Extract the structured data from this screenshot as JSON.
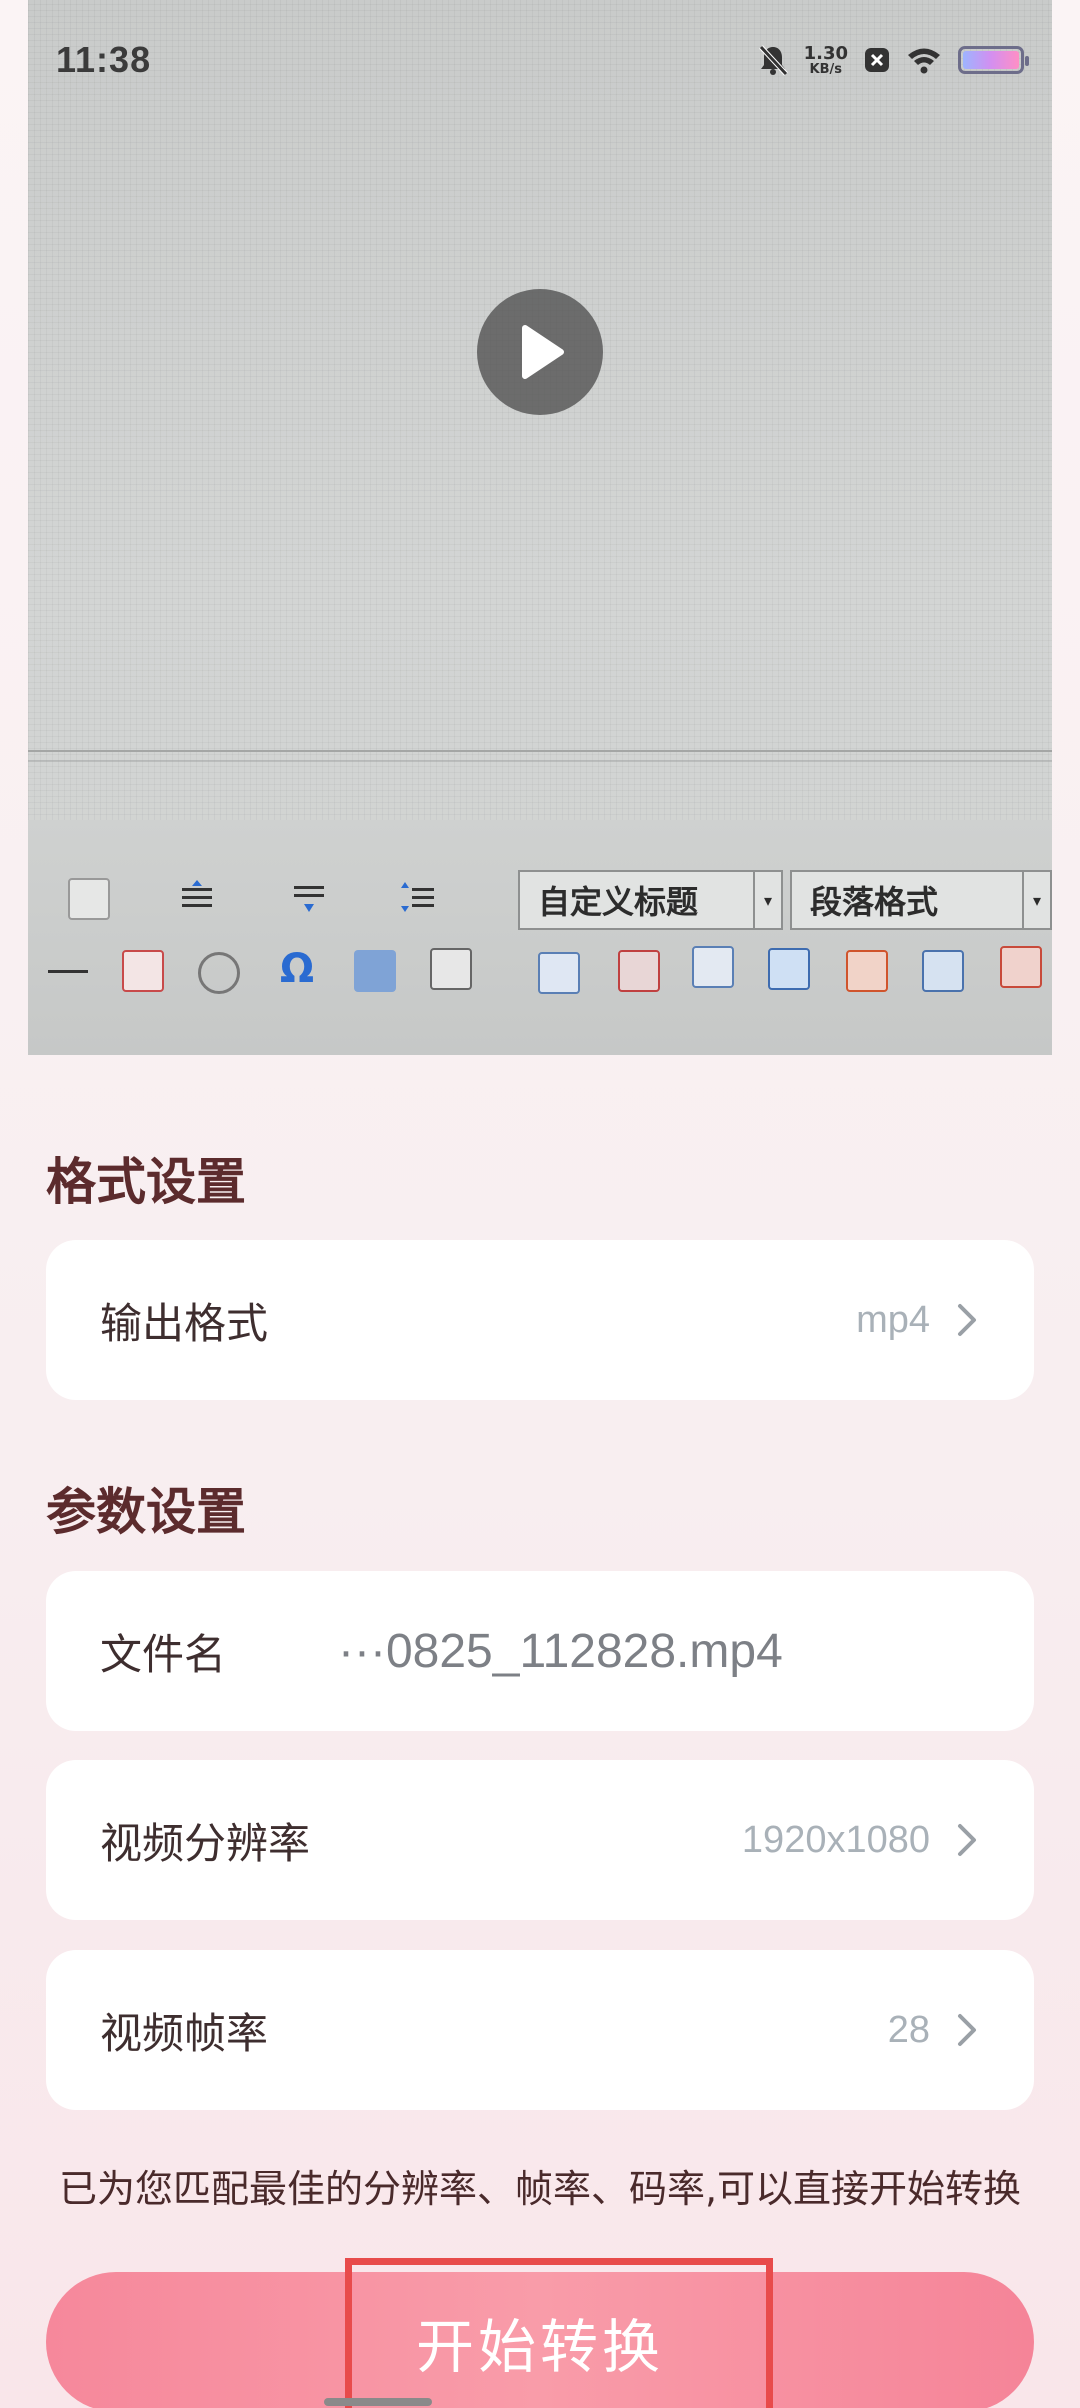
{
  "status_bar": {
    "time": "11:38",
    "net_speed_value": "1.30",
    "net_speed_unit": "KB/s",
    "icons": [
      "bell-muted-icon",
      "notification-x-icon",
      "wifi-icon",
      "battery-icon"
    ]
  },
  "video_preview": {
    "play_icon": "play-icon",
    "toolbar_dropdown_1": "自定义标题",
    "toolbar_dropdown_2": "段落格式"
  },
  "format_section": {
    "title": "格式设置",
    "output_format": {
      "label": "输出格式",
      "value": "mp4"
    }
  },
  "params_section": {
    "title": "参数设置",
    "filename": {
      "label": "文件名",
      "value": "···0825_112828.mp4"
    },
    "resolution": {
      "label": "视频分辨率",
      "value": "1920x1080"
    },
    "frame_rate": {
      "label": "视频帧率",
      "value": "28"
    }
  },
  "hint_text": "已为您匹配最佳的分辨率、帧率、码率,可以直接开始转换",
  "convert_button": {
    "label": "开始转换"
  },
  "colors": {
    "accent_pink": "#f6889b",
    "section_title": "#5c2b2d",
    "highlight_box": "#e84b4b"
  }
}
